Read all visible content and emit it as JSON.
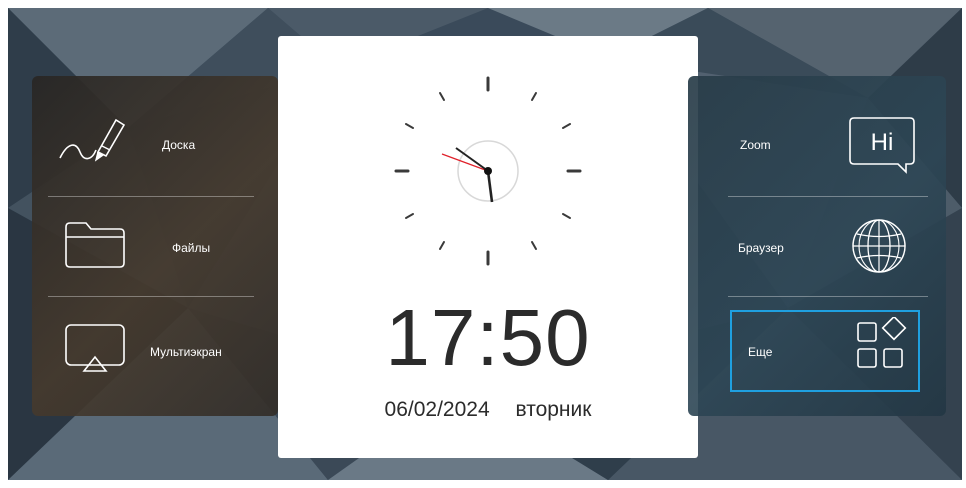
{
  "left_menu": {
    "items": [
      {
        "label": "Доска",
        "icon": "whiteboard-pen-icon"
      },
      {
        "label": "Файлы",
        "icon": "folder-icon"
      },
      {
        "label": "Мультиэкран",
        "icon": "screen-cast-icon"
      }
    ]
  },
  "clock": {
    "time": "17:50",
    "date": "06/02/2024",
    "weekday": "вторник"
  },
  "right_menu": {
    "items": [
      {
        "label": "Zoom",
        "icon": "zoom-hi-icon",
        "icon_text": "Hi"
      },
      {
        "label": "Браузер",
        "icon": "globe-icon"
      },
      {
        "label": "Еще",
        "icon": "apps-grid-icon",
        "selected": true
      }
    ]
  },
  "colors": {
    "selection_border": "#1fa0e0",
    "clock_second_hand": "#e0202a"
  }
}
